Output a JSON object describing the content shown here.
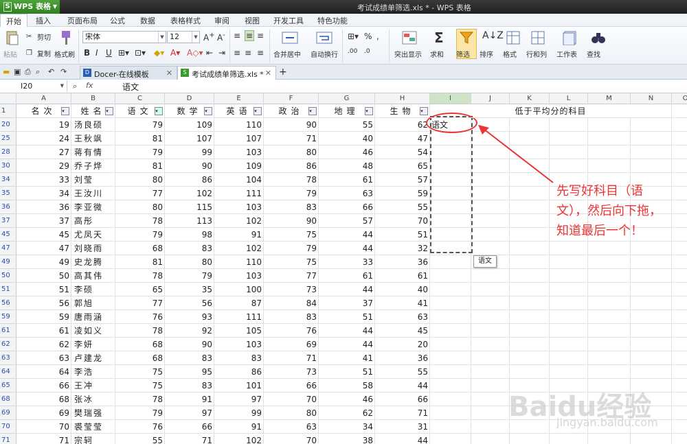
{
  "app": {
    "name": "WPS 表格",
    "window_title": "考试成绩单筛选.xls * - WPS 表格"
  },
  "menus": [
    "开始",
    "插入",
    "页面布局",
    "公式",
    "数据",
    "表格样式",
    "审阅",
    "视图",
    "开发工具",
    "特色功能"
  ],
  "ribbon": {
    "paste": "粘贴",
    "cut": "剪切",
    "copy": "复制",
    "format_painter": "格式刷",
    "font_name": "宋体",
    "font_size": "12",
    "merge_center": "合并居中",
    "wrap_text": "自动换行",
    "number_format": "%",
    "highlight": "突出显示",
    "sum": "求和",
    "filter": "筛选",
    "sort": "排序",
    "format": "格式",
    "row_col": "行和列",
    "worksheet": "工作表",
    "find": "查找"
  },
  "tabs": [
    {
      "label": "Docer-在线模板",
      "active": false
    },
    {
      "label": "考试成绩单筛选.xls *",
      "active": true
    }
  ],
  "formula_bar": {
    "cell_ref": "I20",
    "fx": "fx",
    "content": "语文"
  },
  "columns": [
    "A",
    "B",
    "C",
    "D",
    "E",
    "F",
    "G",
    "H",
    "I",
    "J",
    "K",
    "L",
    "M",
    "N",
    "O"
  ],
  "header_row": {
    "row_num": "1",
    "cells": [
      "名次",
      "姓名",
      "语文",
      "数学",
      "英语",
      "政治",
      "地理",
      "生物"
    ],
    "merged_title": "低于平均分的科目"
  },
  "rows": [
    {
      "r": "20",
      "v": [
        "19",
        "汤良硕",
        "79",
        "109",
        "110",
        "90",
        "55",
        "62"
      ],
      "i": "语文"
    },
    {
      "r": "25",
      "v": [
        "24",
        "王秋飒",
        "81",
        "107",
        "107",
        "71",
        "40",
        "47"
      ],
      "i": ""
    },
    {
      "r": "28",
      "v": [
        "27",
        "蒋有情",
        "79",
        "99",
        "103",
        "80",
        "46",
        "54"
      ],
      "i": ""
    },
    {
      "r": "30",
      "v": [
        "29",
        "乔子烨",
        "81",
        "90",
        "109",
        "86",
        "48",
        "65"
      ],
      "i": ""
    },
    {
      "r": "34",
      "v": [
        "33",
        "刘莹",
        "80",
        "86",
        "104",
        "78",
        "61",
        "57"
      ],
      "i": ""
    },
    {
      "r": "35",
      "v": [
        "34",
        "王汝川",
        "77",
        "102",
        "111",
        "79",
        "63",
        "59"
      ],
      "i": ""
    },
    {
      "r": "36",
      "v": [
        "36",
        "李亚微",
        "80",
        "115",
        "103",
        "83",
        "66",
        "55"
      ],
      "i": ""
    },
    {
      "r": "37",
      "v": [
        "37",
        "高彤",
        "78",
        "113",
        "102",
        "90",
        "57",
        "70"
      ],
      "i": ""
    },
    {
      "r": "45",
      "v": [
        "45",
        "尤凤天",
        "79",
        "98",
        "91",
        "75",
        "44",
        "51"
      ],
      "i": ""
    },
    {
      "r": "47",
      "v": [
        "47",
        "刘晓雨",
        "68",
        "83",
        "102",
        "79",
        "44",
        "32"
      ],
      "i": ""
    },
    {
      "r": "49",
      "v": [
        "49",
        "史龙腾",
        "81",
        "80",
        "110",
        "75",
        "33",
        "36"
      ],
      "i": ""
    },
    {
      "r": "50",
      "v": [
        "50",
        "高其伟",
        "78",
        "79",
        "103",
        "77",
        "61",
        "61"
      ],
      "i": ""
    },
    {
      "r": "51",
      "v": [
        "51",
        "李硕",
        "65",
        "35",
        "100",
        "73",
        "44",
        "40"
      ],
      "i": ""
    },
    {
      "r": "56",
      "v": [
        "56",
        "郭旭",
        "77",
        "56",
        "87",
        "84",
        "37",
        "41"
      ],
      "i": ""
    },
    {
      "r": "59",
      "v": [
        "59",
        "唐雨涵",
        "76",
        "93",
        "111",
        "83",
        "51",
        "63"
      ],
      "i": ""
    },
    {
      "r": "61",
      "v": [
        "61",
        "凌如义",
        "78",
        "92",
        "105",
        "76",
        "44",
        "45"
      ],
      "i": ""
    },
    {
      "r": "62",
      "v": [
        "62",
        "李妍",
        "68",
        "90",
        "103",
        "69",
        "44",
        "20"
      ],
      "i": ""
    },
    {
      "r": "63",
      "v": [
        "63",
        "卢建龙",
        "68",
        "83",
        "83",
        "71",
        "41",
        "36"
      ],
      "i": ""
    },
    {
      "r": "64",
      "v": [
        "64",
        "李浩",
        "75",
        "95",
        "86",
        "73",
        "51",
        "55"
      ],
      "i": ""
    },
    {
      "r": "65",
      "v": [
        "66",
        "王冲",
        "75",
        "83",
        "101",
        "66",
        "58",
        "44"
      ],
      "i": ""
    },
    {
      "r": "68",
      "v": [
        "68",
        "张冰",
        "78",
        "91",
        "97",
        "70",
        "46",
        "66"
      ],
      "i": ""
    },
    {
      "r": "69",
      "v": [
        "69",
        "樊瑞强",
        "79",
        "97",
        "99",
        "80",
        "62",
        "71"
      ],
      "i": ""
    },
    {
      "r": "70",
      "v": [
        "70",
        "裘莹莹",
        "76",
        "66",
        "91",
        "63",
        "34",
        "31"
      ],
      "i": ""
    },
    {
      "r": "71",
      "v": [
        "71",
        "宗轲",
        "55",
        "71",
        "102",
        "70",
        "38",
        "44"
      ],
      "i": ""
    }
  ],
  "drag_tooltip": "语文",
  "annotation": {
    "text": "先写好科目（语文），然后向下拖，知道最后一个！",
    "color": "#e33333"
  },
  "watermark": {
    "logo": "Baidu经验",
    "url": "jingyan.baidu.com"
  }
}
